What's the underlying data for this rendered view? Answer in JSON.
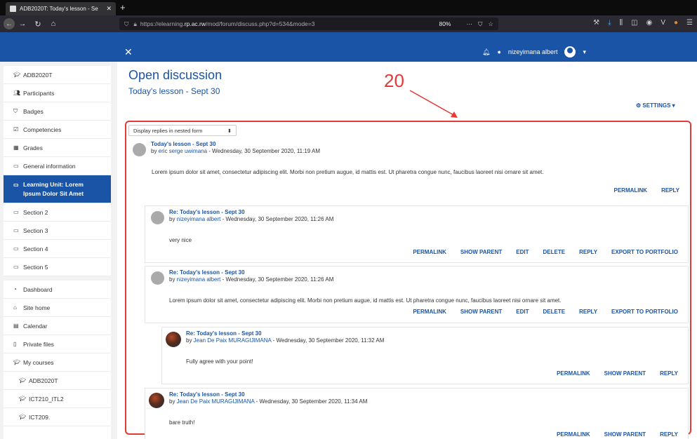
{
  "browser": {
    "tab_title": "ADB2020T: Today's lesson - Se",
    "url_prefix": "https://elearning.",
    "url_host": "rp.ac.rw",
    "url_path": "/mod/forum/discuss.php?d=534&mode=3",
    "zoom": "80%"
  },
  "navbar": {
    "user_name": "nizeyimana albert"
  },
  "sidebar": {
    "items": [
      {
        "label": "ADB2020T"
      },
      {
        "label": "Participants"
      },
      {
        "label": "Badges"
      },
      {
        "label": "Competencies"
      },
      {
        "label": "Grades"
      },
      {
        "label": "General information"
      },
      {
        "label": "Learning Unit: Lorem Ipsum Dolor Sit Amet"
      },
      {
        "label": "Section 2"
      },
      {
        "label": "Section 3"
      },
      {
        "label": "Section 4"
      },
      {
        "label": "Section 5"
      }
    ],
    "items2": [
      {
        "label": "Dashboard"
      },
      {
        "label": "Site home"
      },
      {
        "label": "Calendar"
      },
      {
        "label": "Private files"
      },
      {
        "label": "My courses"
      },
      {
        "label": "ADB2020T"
      },
      {
        "label": "ICT210_ITL2"
      },
      {
        "label": "ICT209."
      }
    ]
  },
  "page": {
    "title": "Open discussion",
    "subtitle": "Today's lesson - Sept 30",
    "settings_label": "SETTINGS",
    "annotation_number": "20",
    "display_mode": "Display replies in nested form"
  },
  "posts": [
    {
      "subject": "Today's lesson - Sept 30",
      "by": "by ",
      "author": "eric serge uwimana",
      "date": " - Wednesday, 30 September 2020, 11:19 AM",
      "message": "Lorem ipsum dolor sit amet, consectetur adipiscing elit. Morbi non pretium augue, id mattis est. Ut pharetra congue nunc, faucibus laoreet nisi ornare sit amet.",
      "commands": [
        "PERMALINK",
        "REPLY"
      ]
    },
    {
      "subject": "Re: Today's lesson - Sept 30",
      "by": "by ",
      "author": "nizeyimana albert",
      "date": " - Wednesday, 30 September 2020, 11:26 AM",
      "message": "very nice",
      "commands": [
        "PERMALINK",
        "SHOW PARENT",
        "EDIT",
        "DELETE",
        "REPLY",
        "EXPORT TO PORTFOLIO"
      ]
    },
    {
      "subject": "Re: Today's lesson - Sept 30",
      "by": "by ",
      "author": "nizeyimana albert",
      "date": " - Wednesday, 30 September 2020, 11:26 AM",
      "message": "Lorem ipsum dolor sit amet, consectetur adipiscing elit. Morbi non pretium augue, id mattis est. Ut pharetra congue nunc, faucibus laoreet nisi ornare sit amet.",
      "commands": [
        "PERMALINK",
        "SHOW PARENT",
        "EDIT",
        "DELETE",
        "REPLY",
        "EXPORT TO PORTFOLIO"
      ]
    },
    {
      "subject": "Re: Today's lesson - Sept 30",
      "by": "by ",
      "author": "Jean De Paix MURAGIJIMANA",
      "date": " - Wednesday, 30 September 2020, 11:32 AM",
      "message": "Fully agree with your point!",
      "commands": [
        "PERMALINK",
        "SHOW PARENT",
        "REPLY"
      ]
    },
    {
      "subject": "Re: Today's lesson - Sept 30",
      "by": "by ",
      "author": "Jean De Paix MURAGIJIMANA",
      "date": " - Wednesday, 30 September 2020, 11:34 AM",
      "message": "bare truth!",
      "commands": [
        "PERMALINK",
        "SHOW PARENT",
        "REPLY"
      ]
    }
  ],
  "colors": {
    "brand": "#1a54a6",
    "annotation": "#e53935"
  }
}
